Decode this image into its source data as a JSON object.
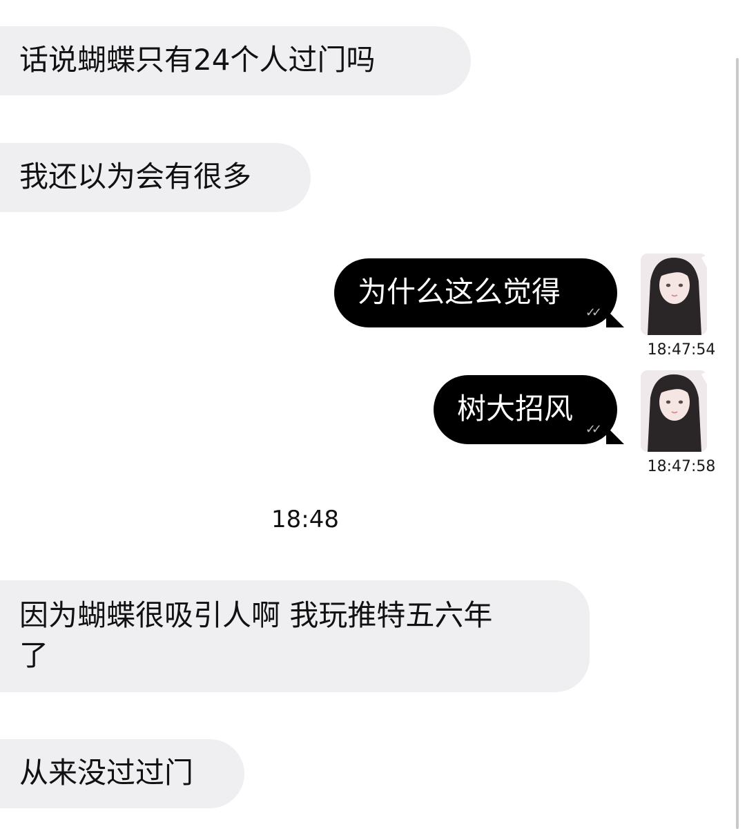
{
  "messages": {
    "m1": {
      "text": "话说蝴蝶只有24个人过门吗"
    },
    "m2": {
      "text": "我还以为会有很多"
    },
    "m3": {
      "text": "为什么这么觉得",
      "check": "✓✓",
      "time": "18:47:54"
    },
    "m4": {
      "text": "树大招风",
      "check": "✓✓",
      "time": "18:47:58"
    },
    "divider": {
      "time": "18:48"
    },
    "m5": {
      "line1": "因为蝴蝶很吸引人啊 我玩推特五六年",
      "line2": "了"
    },
    "m6": {
      "text": "从来没过过门"
    }
  },
  "colors": {
    "incoming_bubble": "#efeff2",
    "outgoing_bubble": "#000000",
    "background": "#ffffff"
  }
}
